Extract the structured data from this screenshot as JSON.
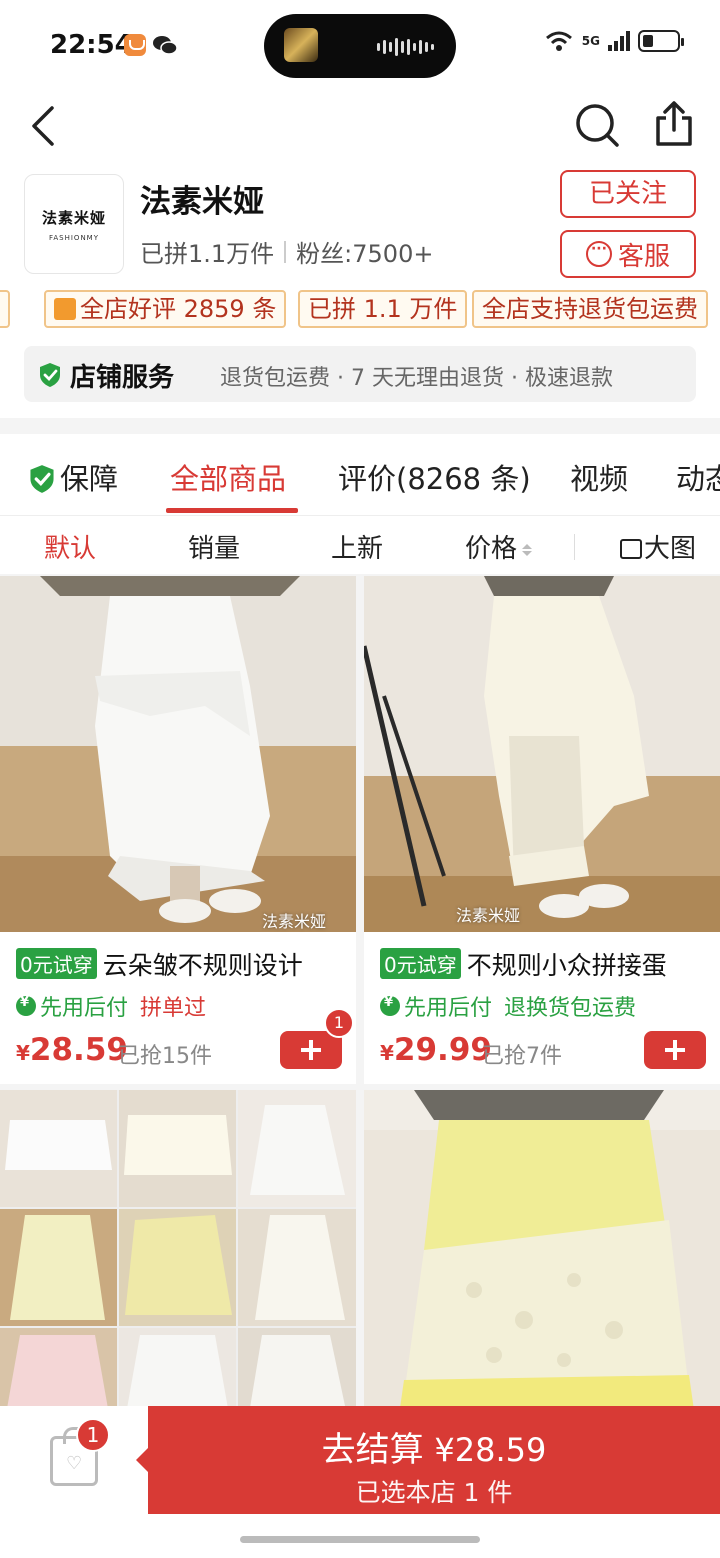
{
  "status_bar": {
    "time": "22:54",
    "network": "5G"
  },
  "header": {
    "shop_logo_cn": "法素米娅",
    "shop_logo_en": "FASHIONMY",
    "shop_name": "法素米娅",
    "sold_count": "已拼1.1万件",
    "fans": "粉丝:7500+",
    "follow_label": "已关注",
    "service_label": "客服"
  },
  "tags": [
    {
      "label": "全店好评 2859 条"
    },
    {
      "label": "已拼 1.1 万件"
    },
    {
      "label": "全店支持退货包运费"
    }
  ],
  "shop_service": {
    "title": "店铺服务",
    "desc": "退货包运费 · 7 天无理由退货 · 极速退款"
  },
  "tabs": [
    {
      "label": "保障"
    },
    {
      "label": "全部商品",
      "active": true
    },
    {
      "label": "评价(8268 条)"
    },
    {
      "label": "视频"
    },
    {
      "label": "动态"
    }
  ],
  "sort": {
    "default": "默认",
    "sales": "销量",
    "new": "上新",
    "price": "价格",
    "big_image": "大图"
  },
  "products": [
    {
      "trial": "0元试穿",
      "title": "云朵皱不规则设计",
      "pay_later": "先用后付",
      "tag2": "拼单过",
      "currency": "¥",
      "price": "28.59",
      "sold": "已抢15件",
      "cart_count": "1",
      "watermark": "法素米娅"
    },
    {
      "trial": "0元试穿",
      "title": "不规则小众拼接蛋",
      "pay_later": "先用后付",
      "tag2": "退换货包运费",
      "currency": "¥",
      "price": "29.99",
      "sold": "已抢7件",
      "watermark": "法素米娅"
    }
  ],
  "bottom": {
    "cart_count": "1",
    "checkout_label": "去结算",
    "checkout_price": "¥28.59",
    "checkout_sub": "已选本店 1 件"
  },
  "colors": {
    "accent": "#d83a35",
    "green": "#2aa142",
    "tag_border": "#f0c489"
  }
}
